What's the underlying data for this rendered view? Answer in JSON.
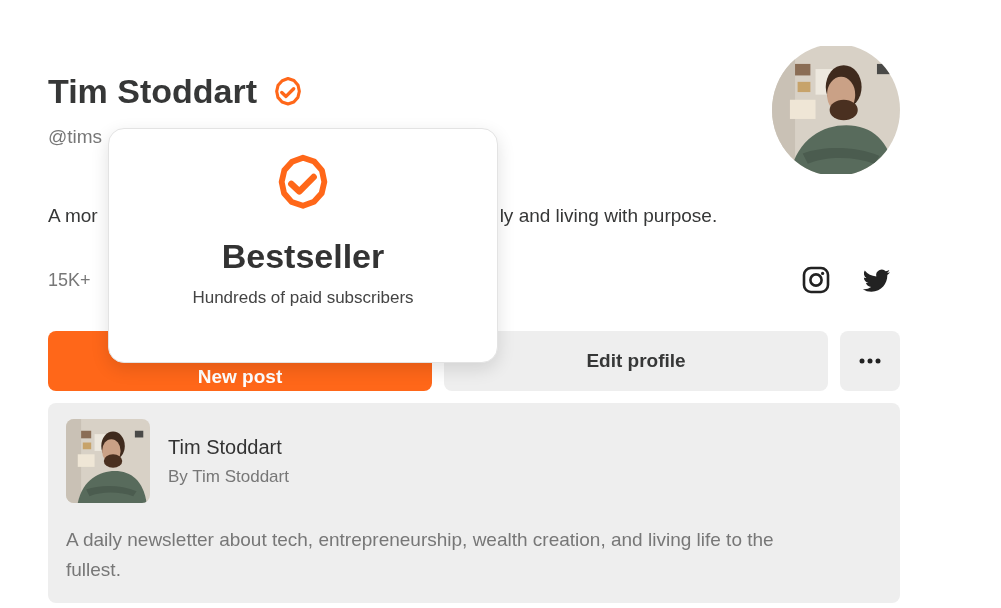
{
  "profile": {
    "name": "Tim Stoddart",
    "verified": true,
    "handle": "@tims",
    "bio": [
      "A mor",
      "ly and living with purpose."
    ],
    "stats": "15K+",
    "social": [
      {
        "kind": "instagram"
      },
      {
        "kind": "twitter"
      }
    ]
  },
  "buttons": [
    {
      "kind": "primary",
      "label": "New post"
    },
    {
      "kind": "secondary",
      "label": "Edit profile"
    },
    {
      "kind": "more"
    }
  ],
  "publication": {
    "title": "Tim Stoddart",
    "byline": "By Tim Stoddart",
    "description": "A daily newsletter about tech, entrepreneurship, wealth creation, and living life to the fullest."
  },
  "popover": {
    "title": "Bestseller",
    "subtitle": "Hundreds of paid subscribers"
  }
}
